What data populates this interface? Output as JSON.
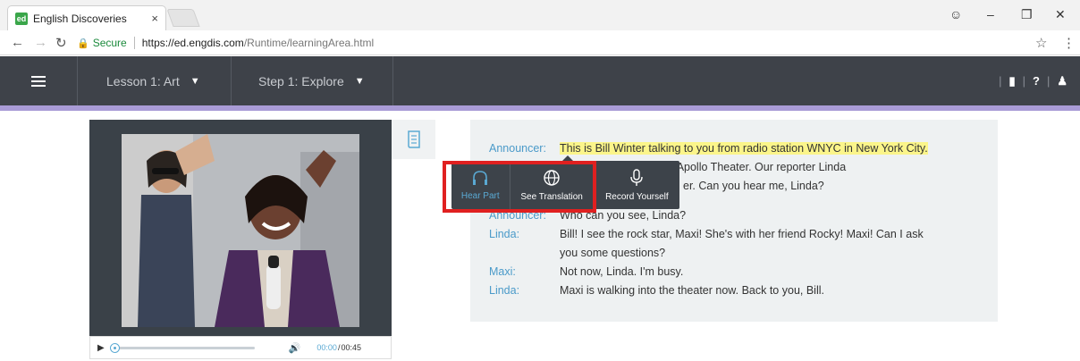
{
  "browser": {
    "tab_title": "English Discoveries",
    "tab_favicon": "ed",
    "tab_close": "×",
    "secure_label": "Secure",
    "url_host": "https://ed.engdis.com",
    "url_path": "/Runtime/learningArea.html"
  },
  "header": {
    "lesson_label": "Lesson 1: Art",
    "step_label": "Step 1: Explore",
    "help": "?"
  },
  "player": {
    "time_current": "00:00",
    "time_separator": "/",
    "time_total": "00:45",
    "progress": 0
  },
  "toolbar": {
    "hear_part": "Hear Part",
    "see_translation": "See Translation",
    "record_yourself": "Record Yourself"
  },
  "transcript": {
    "lines": [
      {
        "speaker": "Announcer:",
        "text": "This is Bill Winter talking to you from radio station WNYC in New York City."
      },
      {
        "speaker": "",
        "text": "oll Night at the Apollo Theater. Our reporter Linda"
      },
      {
        "speaker": "",
        "text": "er. Can you hear me, Linda?"
      },
      {
        "speaker": "Announcer:",
        "text": "Who can you see, Linda?"
      },
      {
        "speaker": "Linda:",
        "text": "Bill! I see the rock star, Maxi! She's with her friend Rocky! Maxi! Can I ask"
      },
      {
        "speaker": "",
        "text": "you some questions?"
      },
      {
        "speaker": "Maxi:",
        "text": "Not now, Linda. I'm busy."
      },
      {
        "speaker": "Linda:",
        "text": "Maxi is walking into the theater now. Back to you, Bill."
      }
    ]
  },
  "colors": {
    "header_bg": "#3e4249",
    "accent_stripe": "#a99bd6",
    "speaker_blue": "#4a9ac9",
    "highlight": "#fbf58a",
    "callout_red": "#e02020"
  }
}
